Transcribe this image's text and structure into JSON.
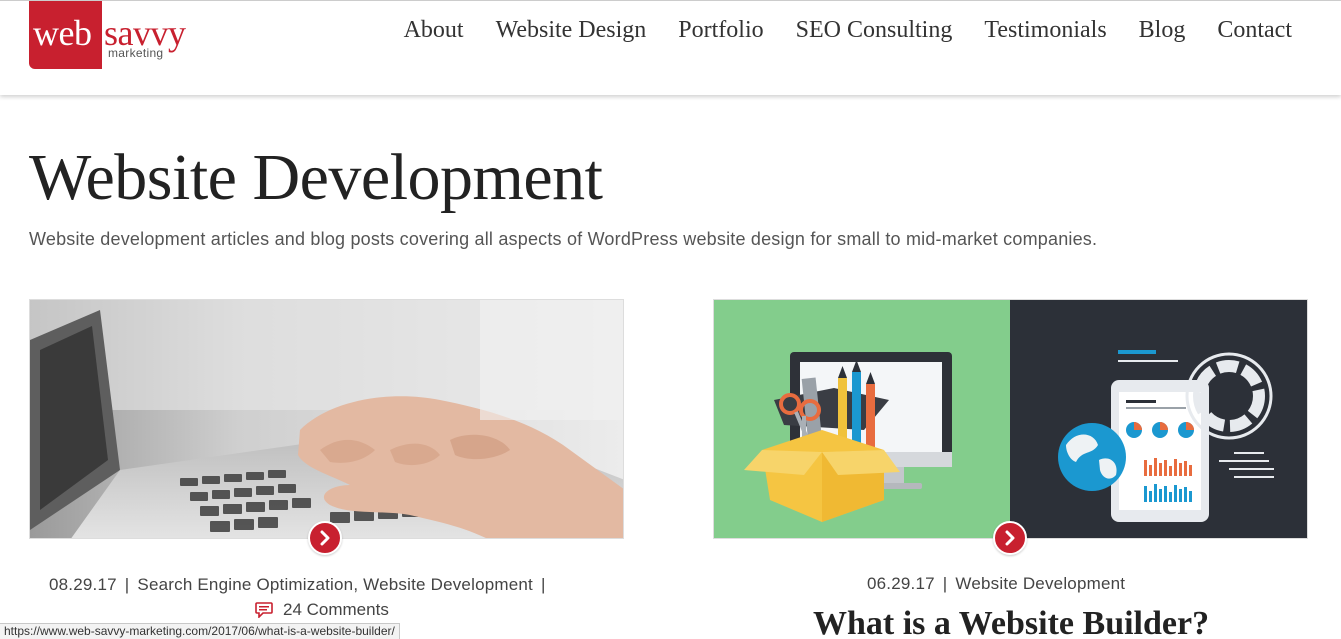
{
  "header": {
    "logo": {
      "word1": "web",
      "word2": "savvy",
      "word3": "marketing"
    },
    "nav": [
      "About",
      "Website Design",
      "Portfolio",
      "SEO Consulting",
      "Testimonials",
      "Blog",
      "Contact"
    ]
  },
  "page": {
    "title": "Website Development",
    "subtitle": "Website development articles and blog posts covering all aspects of WordPress website design for small to mid-market companies."
  },
  "posts": [
    {
      "date": "08.29.17",
      "categories": "Search Engine Optimization, Website Development",
      "trailing_sep": "|",
      "comments": "24 Comments"
    },
    {
      "date": "06.29.17",
      "categories": "Website Development",
      "title": "What is a Website Builder?"
    }
  ],
  "status_bar": {
    "url": "https://www.web-savvy-marketing.com/2017/06/what-is-a-website-builder/"
  },
  "colors": {
    "brand_red": "#c8202f",
    "green_panel": "#83cd8c",
    "dark_panel": "#2c3038"
  }
}
